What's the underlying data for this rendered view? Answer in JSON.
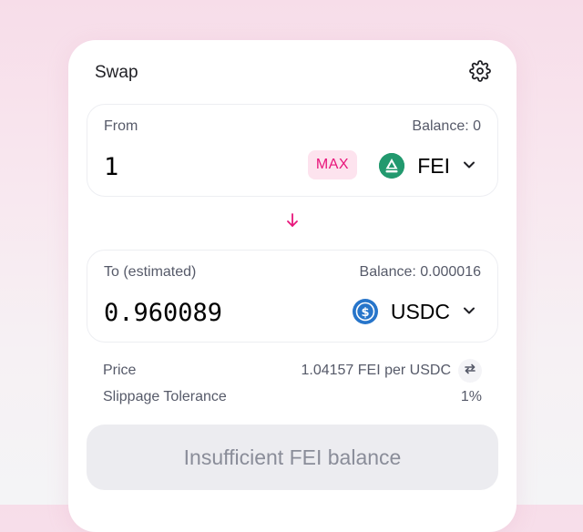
{
  "header": {
    "title": "Swap",
    "settings_icon": "gear-icon"
  },
  "from": {
    "label": "From",
    "balance": "Balance: 0",
    "amount": "1",
    "max_label": "MAX",
    "token_symbol": "FEI",
    "token_icon": "fei-token-icon"
  },
  "switch_icon": "arrow-down-icon",
  "to": {
    "label": "To (estimated)",
    "balance": "Balance: 0.000016",
    "amount": "0.960089",
    "token_symbol": "USDC",
    "token_icon": "usdc-token-icon"
  },
  "details": {
    "price_label": "Price",
    "price_value": "1.04157 FEI per USDC",
    "slippage_label": "Slippage Tolerance",
    "slippage_value": "1%"
  },
  "submit": {
    "label": "Insufficient FEI balance"
  },
  "colors": {
    "accent": "#e8157a",
    "fei_green": "#22996e",
    "usdc_blue": "#2775ca"
  }
}
